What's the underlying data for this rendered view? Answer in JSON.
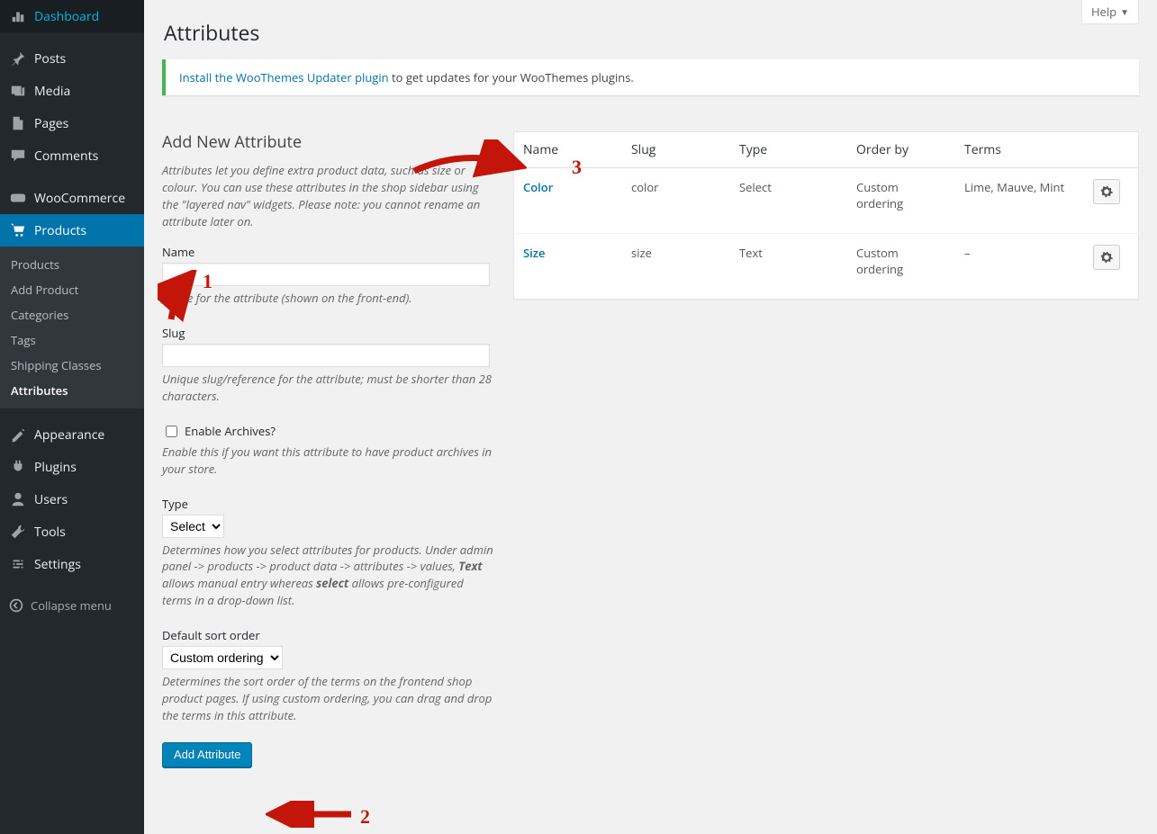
{
  "help_label": "Help",
  "page_title": "Attributes",
  "notice": {
    "link_text": "Install the WooThemes Updater plugin",
    "rest": " to get updates for your WooThemes plugins."
  },
  "sidebar": {
    "items": [
      {
        "label": "Dashboard"
      },
      {
        "label": "Posts"
      },
      {
        "label": "Media"
      },
      {
        "label": "Pages"
      },
      {
        "label": "Comments"
      },
      {
        "label": "WooCommerce"
      },
      {
        "label": "Products"
      },
      {
        "label": "Appearance"
      },
      {
        "label": "Plugins"
      },
      {
        "label": "Users"
      },
      {
        "label": "Tools"
      },
      {
        "label": "Settings"
      }
    ],
    "submenu": [
      {
        "label": "Products"
      },
      {
        "label": "Add Product"
      },
      {
        "label": "Categories"
      },
      {
        "label": "Tags"
      },
      {
        "label": "Shipping Classes"
      },
      {
        "label": "Attributes"
      }
    ],
    "collapse": "Collapse menu"
  },
  "form": {
    "heading": "Add New Attribute",
    "intro": "Attributes let you define extra product data, such as size or colour. You can use these attributes in the shop sidebar using the \"layered nav\" widgets. Please note: you cannot rename an attribute later on.",
    "name_label": "Name",
    "name_value": "",
    "name_desc": "Name for the attribute (shown on the front-end).",
    "slug_label": "Slug",
    "slug_value": "",
    "slug_desc": "Unique slug/reference for the attribute; must be shorter than 28 characters.",
    "archives_label": "Enable Archives?",
    "archives_desc": "Enable this if you want this attribute to have product archives in your store.",
    "type_label": "Type",
    "type_value": "Select",
    "type_desc_1": "Determines how you select attributes for products. Under admin panel -> products -> product data -> attributes -> values, ",
    "type_desc_2": "Text",
    "type_desc_3": " allows manual entry whereas ",
    "type_desc_4": "select",
    "type_desc_5": " allows pre-configured terms in a drop-down list.",
    "sort_label": "Default sort order",
    "sort_value": "Custom ordering",
    "sort_desc": "Determines the sort order of the terms on the frontend shop product pages. If using custom ordering, you can drag and drop the terms in this attribute.",
    "submit": "Add Attribute"
  },
  "table": {
    "headers": [
      "Name",
      "Slug",
      "Type",
      "Order by",
      "Terms",
      ""
    ],
    "rows": [
      {
        "name": "Color",
        "slug": "color",
        "type": "Select",
        "orderby": "Custom ordering",
        "terms": "Lime, Mauve, Mint"
      },
      {
        "name": "Size",
        "slug": "size",
        "type": "Text",
        "orderby": "Custom ordering",
        "terms": "–"
      }
    ]
  },
  "annotations": {
    "n1": "1",
    "n2": "2",
    "n3": "3"
  }
}
